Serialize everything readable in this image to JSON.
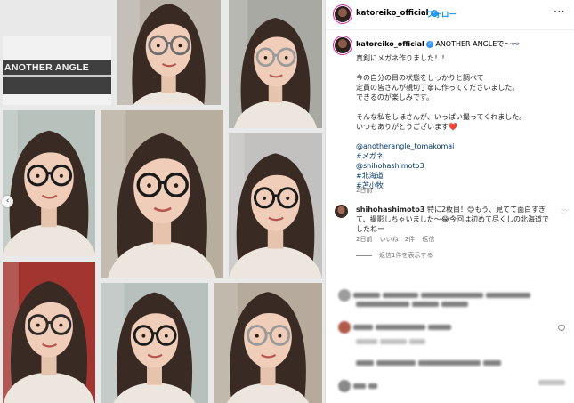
{
  "collage": {
    "sign_text": "ANOTHER ANGLE",
    "photos": [
      {
        "wall": "#b9b2a8",
        "frames": "gray"
      },
      {
        "wall": "#a9a9a3",
        "frames": "silver"
      },
      {
        "wall": "#b7c2bc",
        "frames": "black"
      },
      {
        "wall": "#b8ae9f",
        "frames": "black"
      },
      {
        "wall": "#c3c1c0",
        "frames": "black"
      },
      {
        "wall": "#a33530",
        "frames": "dark"
      },
      {
        "wall": "#b7c0bd",
        "frames": "black"
      },
      {
        "wall": "#b5aa9c",
        "frames": "silver"
      }
    ]
  },
  "header": {
    "username": "katoreiko_official",
    "dot": "•",
    "follow": "フォロー",
    "more": "···"
  },
  "caption": {
    "username": "katoreiko_official",
    "headline": " ANOTHER ANGLEで〜👓",
    "lines": [
      "真剣にメガネ作りました！！",
      "",
      "今の自分の目の状態をしっかりと調べて",
      "定員の皆さんが親切丁寧に作ってくださいました。",
      "できるのが楽しみです。",
      "",
      "そんな私をしほさんが、いっぱい撮ってくれました。",
      "いつもありがとうございます❤️",
      ""
    ],
    "tags": [
      "@anotherangle_tomakomai",
      "#メガネ",
      "@shihohashimoto3",
      "#北海道",
      "#苫小牧"
    ],
    "time": "2日前"
  },
  "comment": {
    "username": "shihohashimoto3",
    "text": " 特に2枚目！😊もう、見てて面白すぎて、撮影しちゃいました〜😂今回は初めて尽くしの北海道でしたねー",
    "meta": [
      "2日前",
      "いいね！2件",
      "返信"
    ],
    "view_replies": "返信1件を表示する",
    "heart": "♡"
  },
  "colors": {
    "follow": "#0095f6",
    "hashtag": "#00376b",
    "muted": "#737373"
  }
}
